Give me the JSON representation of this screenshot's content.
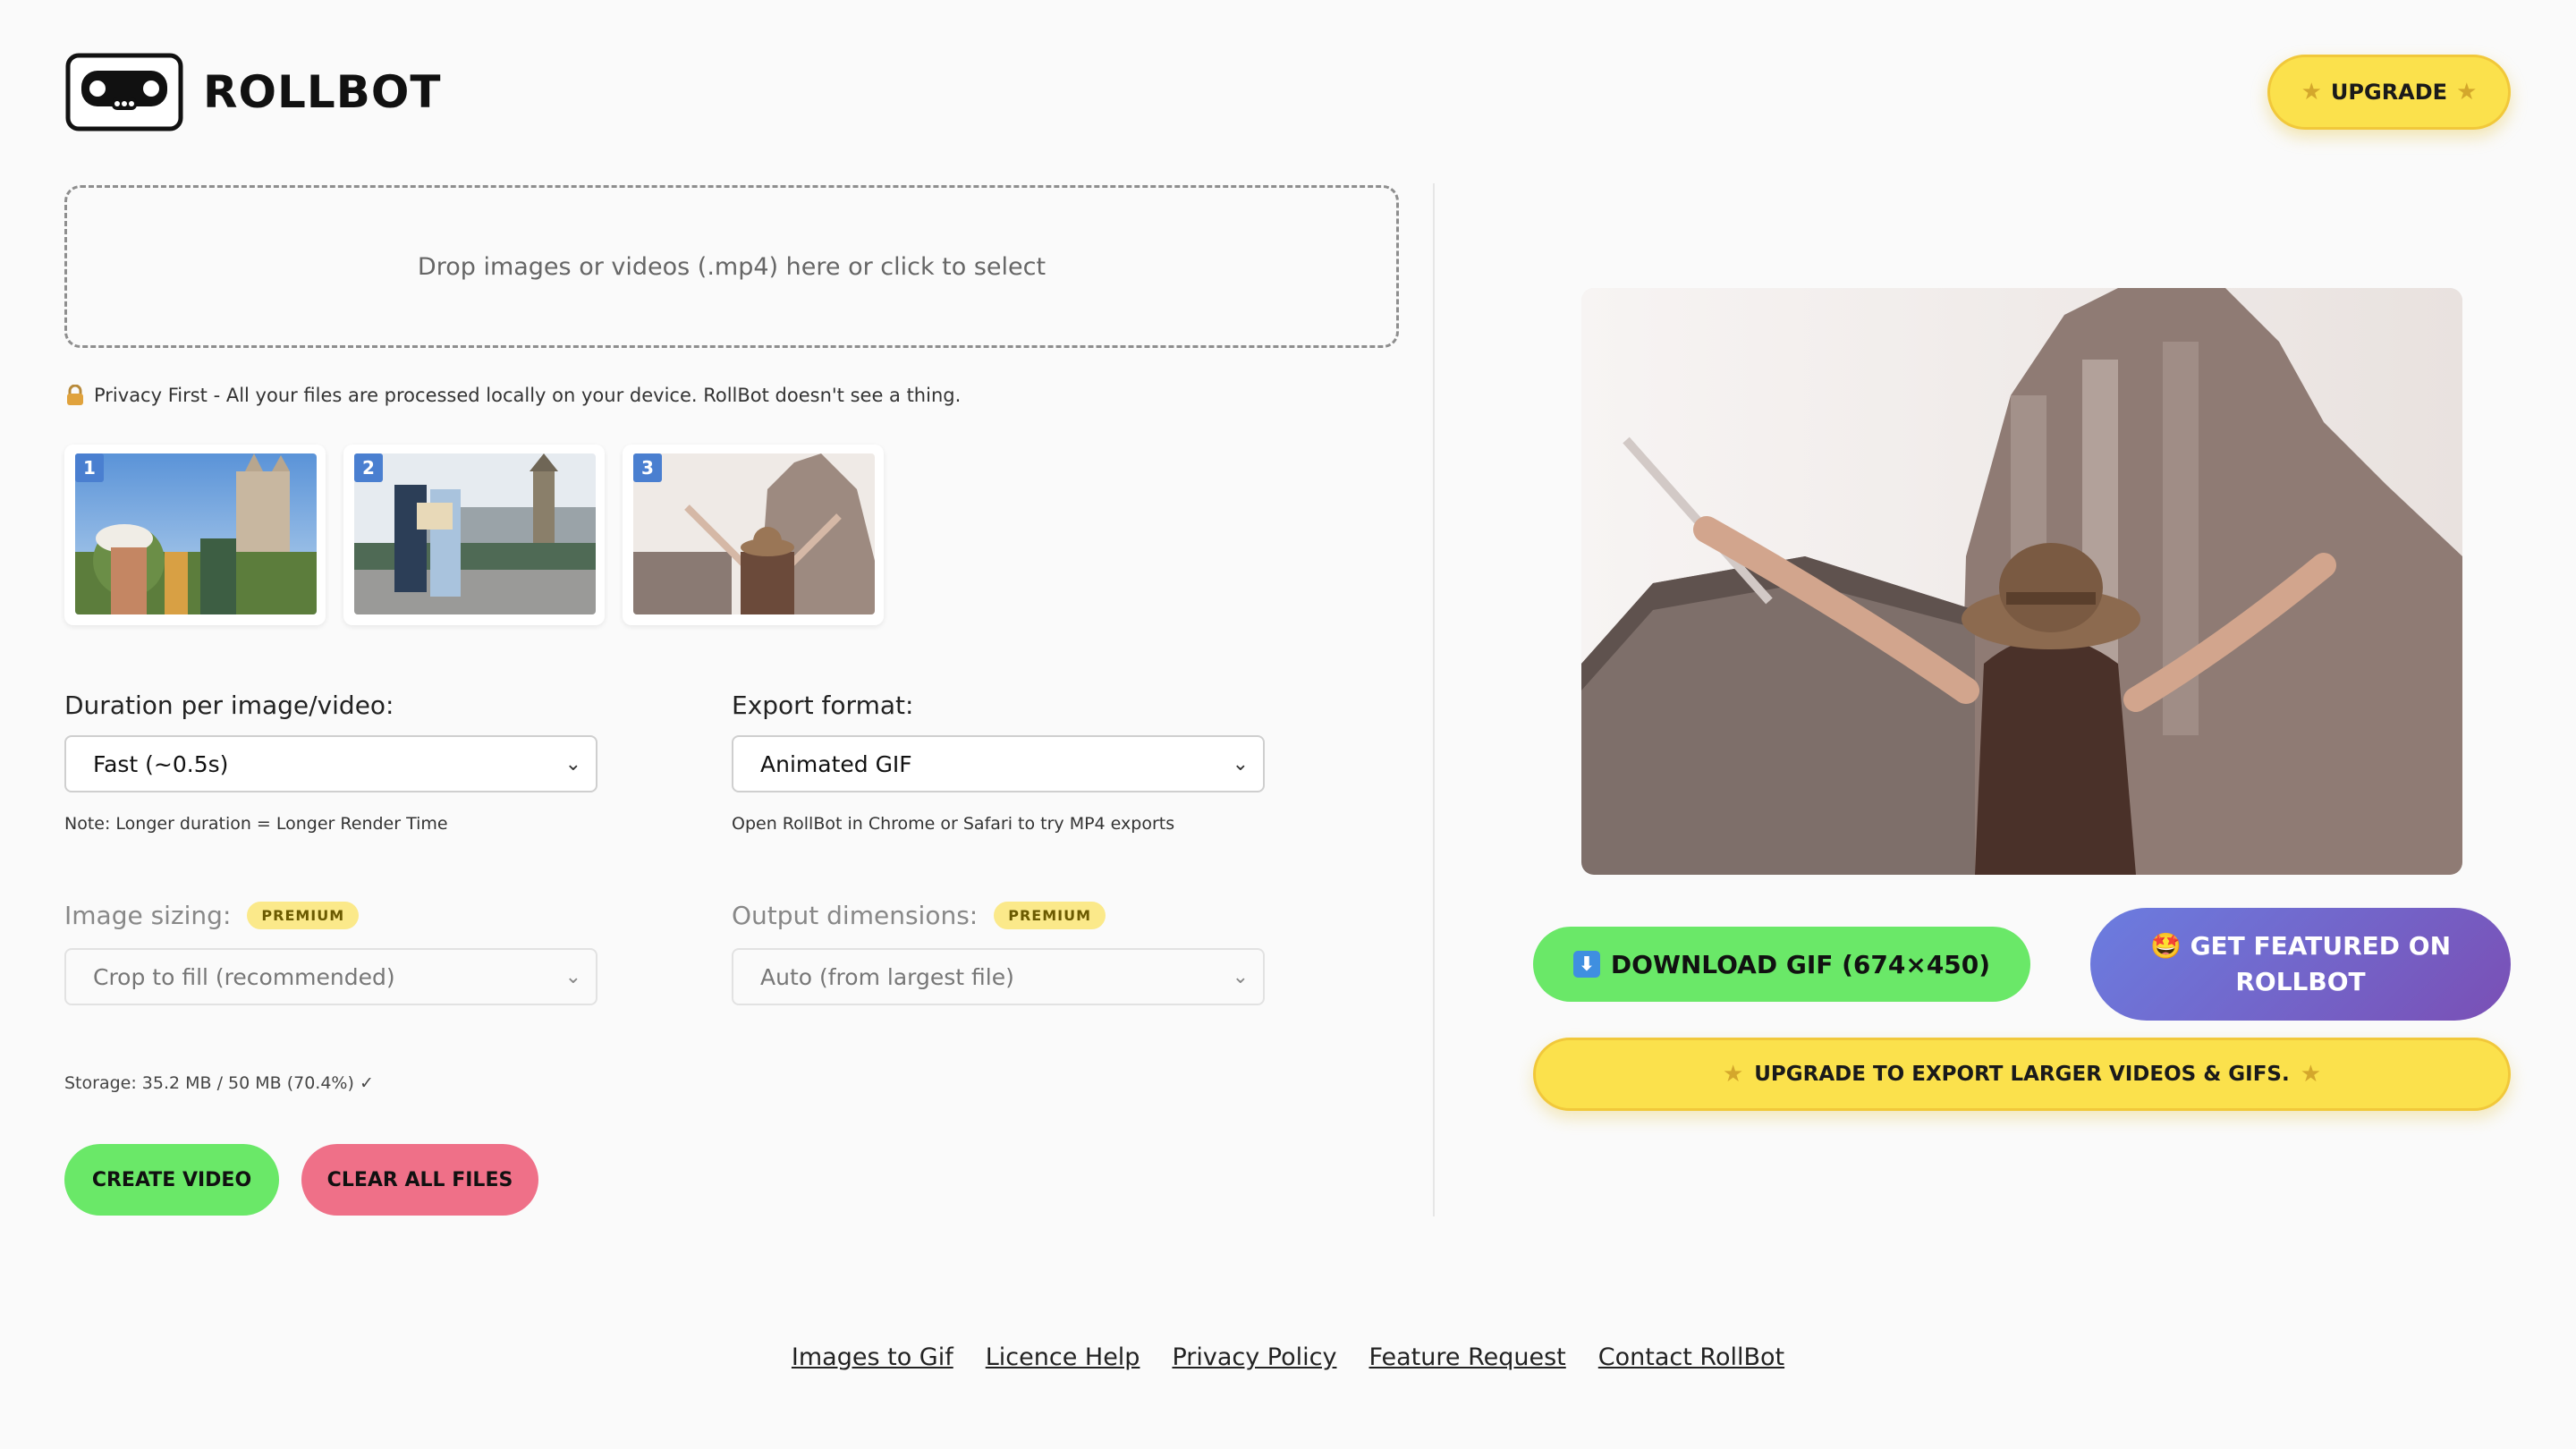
{
  "header": {
    "brand": "ROLLBOT",
    "upgrade_label": "UPGRADE"
  },
  "dropzone": {
    "text": "Drop images or videos (.mp4) here or click to select"
  },
  "privacy": {
    "icon": "lock-icon",
    "text": "Privacy First - All your files are processed locally on your device. RollBot doesn't see a thing."
  },
  "thumbnails": [
    {
      "index": "1"
    },
    {
      "index": "2"
    },
    {
      "index": "3"
    }
  ],
  "form": {
    "duration_label": "Duration per image/video:",
    "duration_value": "Fast (~0.5s)",
    "duration_note": "Note: Longer duration = Longer Render Time",
    "format_label": "Export format:",
    "format_value": "Animated GIF",
    "format_note": "Open RollBot in Chrome or Safari to try MP4 exports",
    "sizing_label": "Image sizing:",
    "sizing_badge": "PREMIUM",
    "sizing_value": "Crop to fill (recommended)",
    "dimensions_label": "Output dimensions:",
    "dimensions_badge": "PREMIUM",
    "dimensions_value": "Auto (from largest file)"
  },
  "storage": "Storage: 35.2 MB / 50 MB (70.4%) ✓",
  "actions": {
    "create": "CREATE VIDEO",
    "clear": "CLEAR ALL FILES"
  },
  "output": {
    "download": "DOWNLOAD GIF (674×450)",
    "featured_line1": "🤩 GET FEATURED ON",
    "featured_line2": "ROLLBOT",
    "upgrade_export": "UPGRADE TO EXPORT LARGER VIDEOS & GIFS."
  },
  "footer": {
    "links": [
      "Images to Gif",
      "Licence Help",
      "Privacy Policy",
      "Feature Request",
      "Contact RollBot"
    ]
  },
  "colors": {
    "green": "#6ae868",
    "pink": "#ef7088",
    "yellow": "#fbe14c",
    "purple_start": "#6b7de0",
    "purple_end": "#7a4fb5",
    "badge_blue": "#4a7fd0"
  }
}
